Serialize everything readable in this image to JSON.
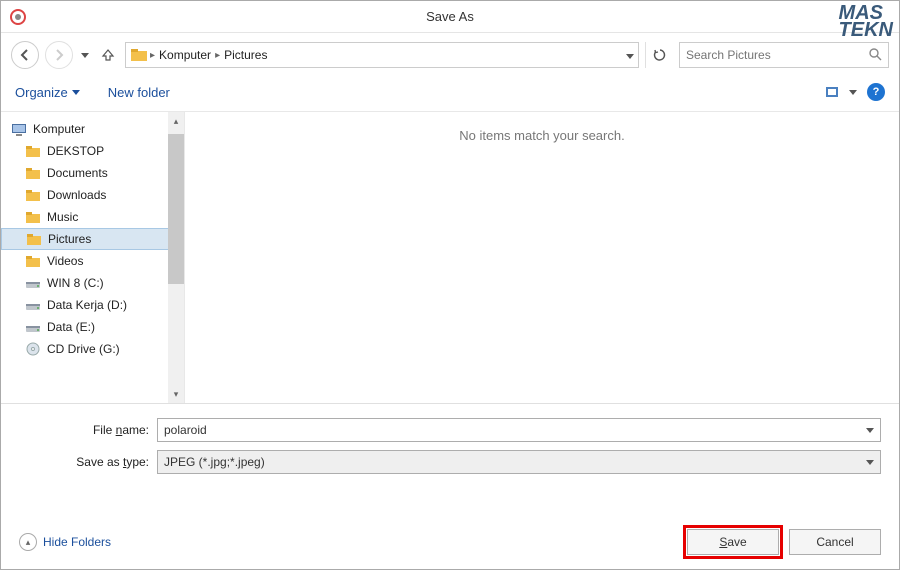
{
  "title": "Save As",
  "watermark": {
    "line1": "MAS",
    "line2": "TEKN"
  },
  "nav": {
    "breadcrumb": [
      "Komputer",
      "Pictures"
    ],
    "search_placeholder": "Search Pictures"
  },
  "toolbar": {
    "organize": "Organize",
    "new_folder": "New folder"
  },
  "sidebar": {
    "root": "Komputer",
    "items": [
      {
        "label": "DEKSTOP",
        "icon": "folder"
      },
      {
        "label": "Documents",
        "icon": "folder"
      },
      {
        "label": "Downloads",
        "icon": "folder"
      },
      {
        "label": "Music",
        "icon": "folder"
      },
      {
        "label": "Pictures",
        "icon": "folder",
        "selected": true
      },
      {
        "label": "Videos",
        "icon": "folder"
      },
      {
        "label": "WIN 8 (C:)",
        "icon": "drive"
      },
      {
        "label": "Data Kerja (D:)",
        "icon": "drive"
      },
      {
        "label": "Data  (E:)",
        "icon": "drive"
      },
      {
        "label": "CD Drive (G:)",
        "icon": "cd"
      }
    ]
  },
  "content_empty": "No items match your search.",
  "form": {
    "filename_label_pre": "File ",
    "filename_label_u": "n",
    "filename_label_post": "ame:",
    "filename_value": "polaroid",
    "type_label_pre": "Save as ",
    "type_label_u": "t",
    "type_label_post": "ype:",
    "type_value": "JPEG (*.jpg;*.jpeg)"
  },
  "footer": {
    "hide_folders": "Hide Folders",
    "save_u": "S",
    "save_rest": "ave",
    "cancel": "Cancel"
  }
}
